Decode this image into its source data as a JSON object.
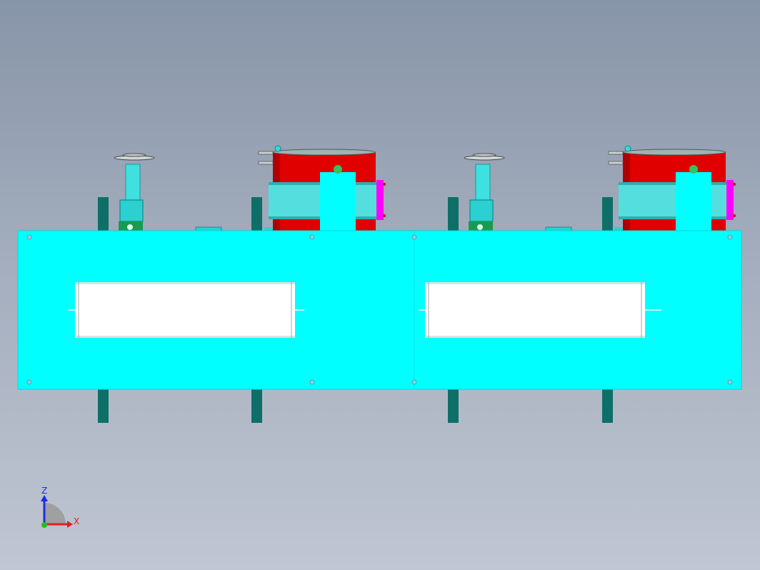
{
  "viewport": {
    "background_top": "#8795a8",
    "background_bottom": "#c0c6d2"
  },
  "model": {
    "colors": {
      "frame": "#00ffff",
      "frame_edge": "#00d8d8",
      "window": "#ffffff",
      "motor": "#e00000",
      "motor_dark": "#b00000",
      "band": "#55dede",
      "leg": "#0e6f68",
      "cap": "#ff00ff",
      "valve_green": "#1a9a50"
    },
    "module_count": 2
  },
  "triad": {
    "z_label": "Z",
    "x_label": "X",
    "z_color": "#1c2fe0",
    "x_color": "#e02020",
    "y_color": "#20c020"
  }
}
